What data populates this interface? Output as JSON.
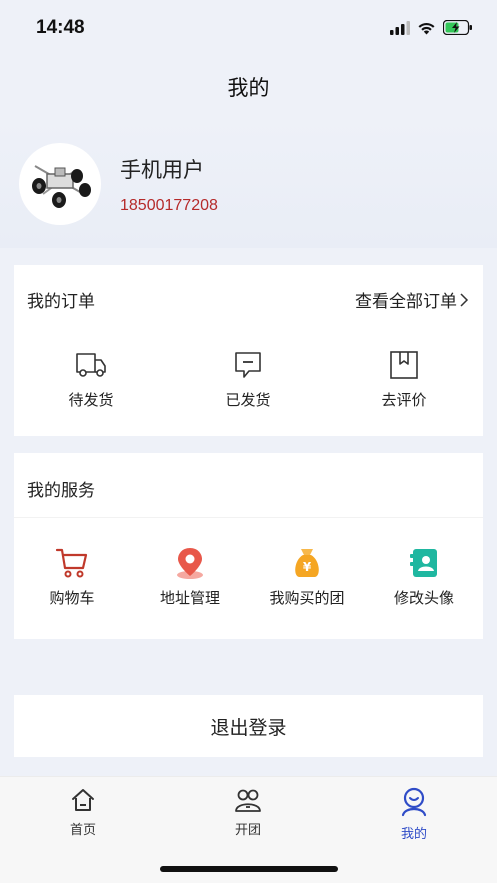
{
  "status_bar": {
    "time": "14:48"
  },
  "nav": {
    "title": "我的"
  },
  "profile": {
    "name": "手机用户",
    "phone": "18500177208"
  },
  "orders": {
    "title": "我的订单",
    "view_all": "查看全部订单",
    "items": [
      {
        "label": "待发货",
        "icon": "truck-icon"
      },
      {
        "label": "已发货",
        "icon": "message-box-icon"
      },
      {
        "label": "去评价",
        "icon": "box-icon"
      }
    ]
  },
  "services": {
    "title": "我的服务",
    "items": [
      {
        "label": "购物车",
        "icon": "cart-icon"
      },
      {
        "label": "地址管理",
        "icon": "location-pin-icon"
      },
      {
        "label": "我购买的团",
        "icon": "money-bag-icon"
      },
      {
        "label": "修改头像",
        "icon": "contact-card-icon"
      }
    ]
  },
  "logout": {
    "label": "退出登录"
  },
  "tabs": [
    {
      "label": "首页",
      "icon": "home-icon"
    },
    {
      "label": "开团",
      "icon": "group-icon"
    },
    {
      "label": "我的",
      "icon": "user-icon",
      "active": true
    }
  ],
  "colors": {
    "accent": "#2f4cc7",
    "phone": "#b52a2a",
    "cart": "#c0392b",
    "pin": "#e8584a",
    "bag": "#f5a623",
    "contact": "#1fb7a0"
  }
}
